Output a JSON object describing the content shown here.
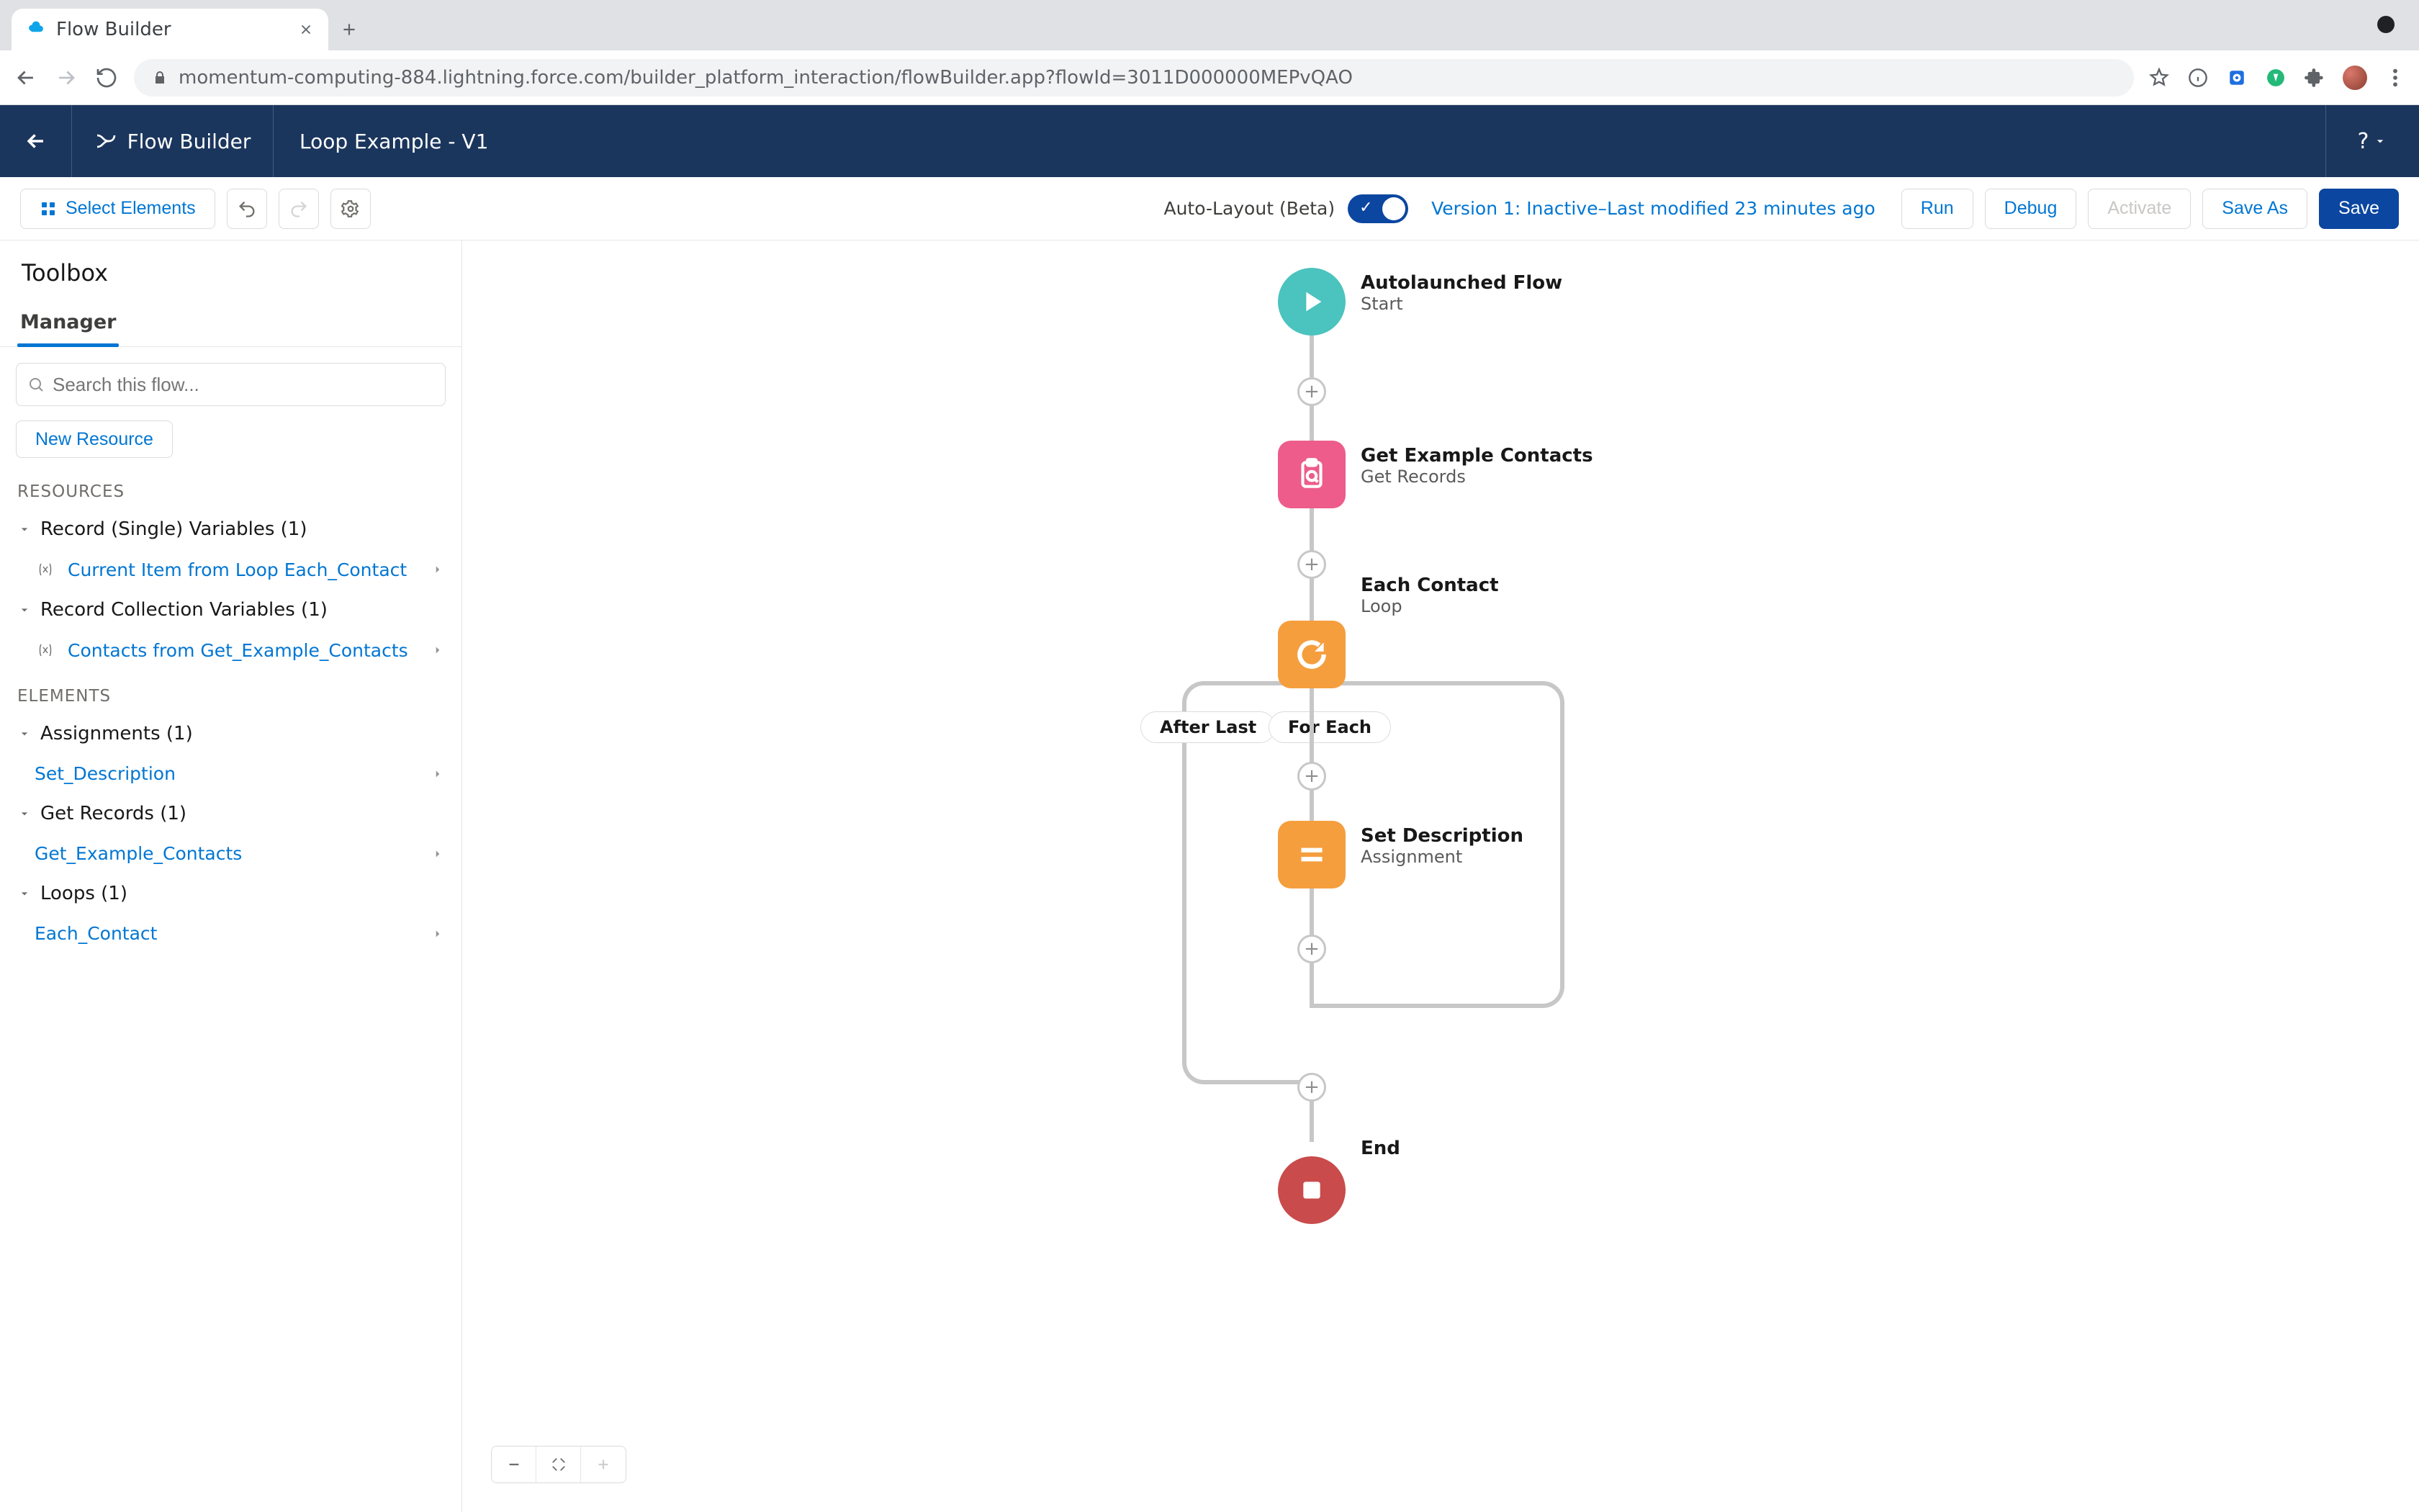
{
  "browser": {
    "tab_title": "Flow Builder",
    "url": "momentum-computing-884.lightning.force.com/builder_platform_interaction/flowBuilder.app?flowId=3011D000000MEPvQAO"
  },
  "appHeader": {
    "title": "Flow Builder",
    "flow_name": "Loop Example - V1",
    "help_label": "?"
  },
  "actionBar": {
    "select_elements": "Select Elements",
    "autolayout_label": "Auto-Layout (Beta)",
    "version_text": "Version 1: Inactive–Last modified 23 minutes ago",
    "run": "Run",
    "debug": "Debug",
    "activate": "Activate",
    "save_as": "Save As",
    "save": "Save"
  },
  "sidebar": {
    "panel_title": "Toolbox",
    "tab_manager": "Manager",
    "search_placeholder": "Search this flow...",
    "new_resource": "New Resource",
    "section_resources": "RESOURCES",
    "section_elements": "ELEMENTS",
    "group_record_single": "Record (Single) Variables (1)",
    "item_current_item": "Current Item from Loop Each_Contact",
    "group_record_collection": "Record Collection Variables (1)",
    "item_contacts_from": "Contacts from Get_Example_Contacts",
    "group_assignments": "Assignments (1)",
    "item_set_description": "Set_Description",
    "group_get_records": "Get Records (1)",
    "item_get_example": "Get_Example_Contacts",
    "group_loops": "Loops (1)",
    "item_each_contact": "Each_Contact"
  },
  "canvas": {
    "start_title": "Autolaunched Flow",
    "start_sub": "Start",
    "getrec_title": "Get Example Contacts",
    "getrec_sub": "Get Records",
    "loop_title": "Each Contact",
    "loop_sub": "Loop",
    "assign_title": "Set Description",
    "assign_sub": "Assignment",
    "end_title": "End",
    "pill_after_last": "After Last",
    "pill_for_each": "For Each"
  }
}
